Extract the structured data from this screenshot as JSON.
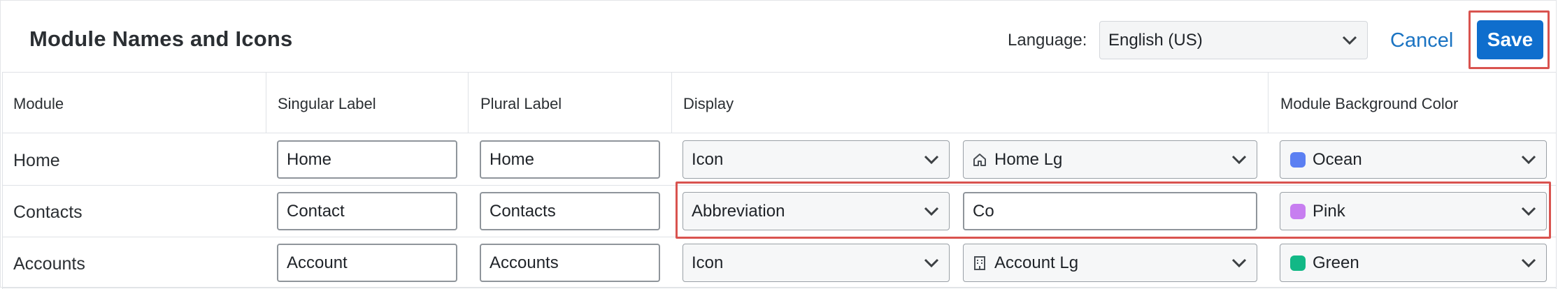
{
  "header": {
    "title": "Module Names and Icons",
    "language_label": "Language:",
    "language_value": "English (US)",
    "cancel_label": "Cancel",
    "save_label": "Save"
  },
  "table": {
    "columns": [
      "Module",
      "Singular Label",
      "Plural Label",
      "Display",
      "Module Background Color"
    ],
    "rows": [
      {
        "module": "Home",
        "singular": "Home",
        "plural": "Home",
        "display": "Icon",
        "display_value": "Home Lg",
        "display_icon": "home-icon",
        "color_name": "Ocean",
        "color_hex": "#5b7ff2"
      },
      {
        "module": "Contacts",
        "singular": "Contact",
        "plural": "Contacts",
        "display": "Abbreviation",
        "display_value": "Co",
        "display_icon": "",
        "color_name": "Pink",
        "color_hex": "#c77ef0"
      },
      {
        "module": "Accounts",
        "singular": "Account",
        "plural": "Accounts",
        "display": "Icon",
        "display_value": "Account Lg",
        "display_icon": "building-icon",
        "color_name": "Green",
        "color_hex": "#12b886"
      }
    ]
  },
  "colors": {
    "accent": "#0f6ecd",
    "highlight": "#d9534f",
    "link": "#1a73c2"
  }
}
